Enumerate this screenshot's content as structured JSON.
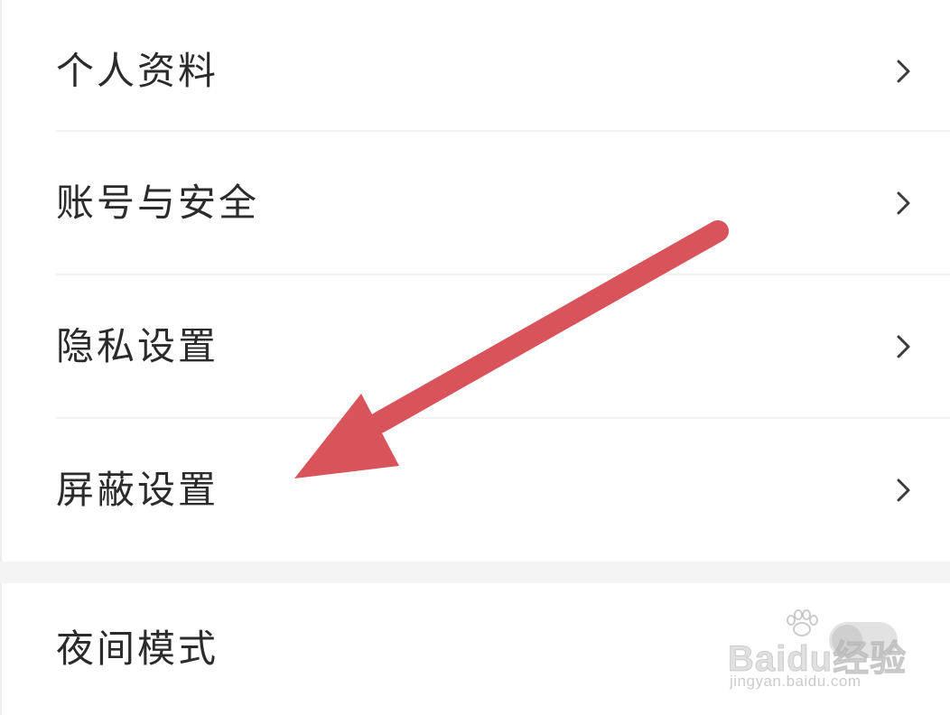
{
  "settings": {
    "items": [
      {
        "label": "个人资料"
      },
      {
        "label": "账号与安全"
      },
      {
        "label": "隐私设置"
      },
      {
        "label": "屏蔽设置"
      }
    ],
    "night_mode": {
      "label": "夜间模式",
      "enabled": false
    }
  },
  "annotation": {
    "arrow_color": "#d9535b",
    "points_to": "屏蔽设置"
  },
  "watermark": {
    "brand": "Baidu经验",
    "url": "jingyan.baidu.com"
  },
  "colors": {
    "text": "#2b2b2b",
    "chevron": "#3a3a3a",
    "divider": "#f2f2f2",
    "group_gap": "#f4f4f4"
  }
}
